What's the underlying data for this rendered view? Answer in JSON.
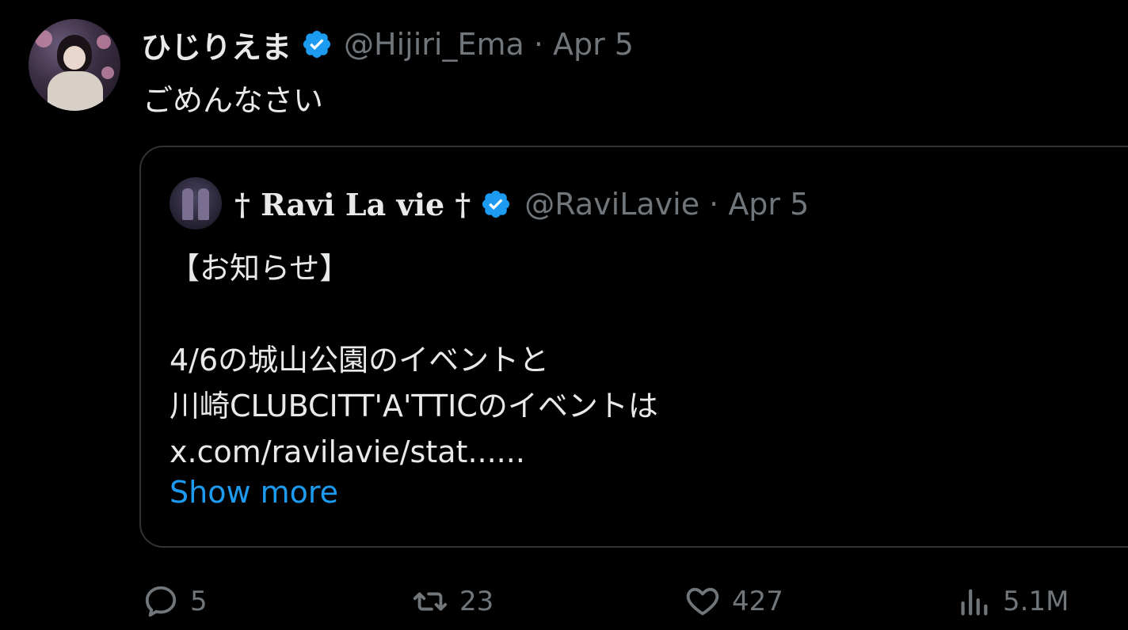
{
  "tweet": {
    "author_name": "ひじりえま",
    "author_handle": "@Hijiri_Ema · Apr 5",
    "text": "ごめんなさい",
    "avatar_alt": "profile-photo"
  },
  "quoted": {
    "author_name": "† Ravi La vie †",
    "author_handle": "@RaviLavie · Apr 5",
    "lines": [
      "【お知らせ】",
      "",
      "4/6の城山公園のイベントと",
      "川崎CLUBCITT'A'TTICのイベントは",
      "x.com/ravilavie/stat......"
    ],
    "show_more": "Show more"
  },
  "actions": {
    "replies": "5",
    "retweets": "23",
    "likes": "427",
    "views": "5.1M"
  },
  "colors": {
    "background": "#000000",
    "text": "#e7e9ea",
    "muted": "#71767b",
    "link": "#1d9bf0",
    "verified": "#1d9bf0",
    "border": "#2f3336"
  }
}
